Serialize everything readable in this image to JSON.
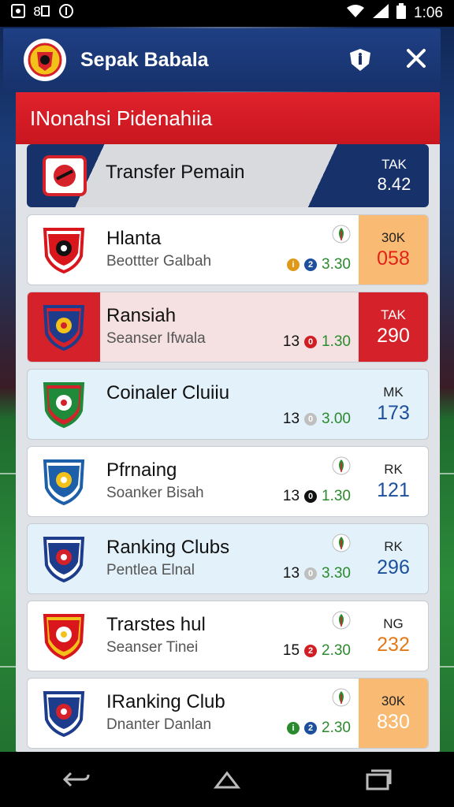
{
  "status_bar": {
    "time": "1:06",
    "left_icons": [
      "photo-icon",
      "notification-icon",
      "data-saver-icon"
    ],
    "right_icons": [
      "wifi-icon",
      "signal-icon",
      "battery-icon"
    ]
  },
  "app_bar": {
    "title": "Sepak Babala",
    "logo": "club-crest-icon",
    "action_icons": [
      "shield-icon",
      "close-icon"
    ]
  },
  "panel": {
    "title": "INonahsi Pidenahiia"
  },
  "featured": {
    "title": "Transfer Pemain",
    "rank_label": "TAK",
    "rank_value": "8.42",
    "colors": {
      "left": "#17326b",
      "right": "#17326b",
      "mid": "#d8dadd"
    }
  },
  "cards": [
    {
      "name": "Hlanta",
      "sub": "Beottter Galbah",
      "stat_num": "",
      "stat_val": "3.30",
      "rank_label": "30K",
      "rank_value": "058",
      "rank_color": "#e2231a",
      "rank_bg": "#f9bb73",
      "card_bg": "#ffffff",
      "trend": true,
      "dot1": "#e0981a",
      "dot2": "#1d4f9c",
      "dot_chars": [
        "i",
        "2"
      ],
      "crest_colors": [
        "#d8161b",
        "#111111",
        "#ffffff"
      ]
    },
    {
      "name": "Ransiah",
      "sub": "Seanser Ifwala",
      "stat_num": "13",
      "stat_val": "1.30",
      "rank_label": "TAK",
      "rank_value": "290",
      "rank_color": "#ffffff",
      "rank_bg": "#d5212a",
      "card_bg": "#f5e1e1",
      "badge_bg": "#d5212a",
      "trend": false,
      "dot1": "#d01e25",
      "dot2": "",
      "dot_chars": [
        "0",
        ""
      ],
      "crest_colors": [
        "#1d3c8c",
        "#f2c21b",
        "#d5212a"
      ]
    },
    {
      "name": "Coinaler Cluiiu",
      "sub": "",
      "stat_num": "13",
      "stat_val": "3.00",
      "rank_label": "MK",
      "rank_value": "173",
      "rank_color": "#1d4f9c",
      "rank_bg": "transparent",
      "card_bg": "#e2f1fa",
      "trend": false,
      "dot1": "#bfbfbf",
      "dot2": "",
      "dot_chars": [
        "0",
        ""
      ],
      "crest_colors": [
        "#1f8a3a",
        "#ffffff",
        "#d5212a"
      ]
    },
    {
      "name": "Pfrnaing",
      "sub": "Soanker Bisah",
      "stat_num": "13",
      "stat_val": "1.30",
      "rank_label": "RK",
      "rank_value": "121",
      "rank_color": "#1d4f9c",
      "rank_bg": "transparent",
      "card_bg": "#ffffff",
      "trend": true,
      "dot1": "#111111",
      "dot2": "",
      "dot_chars": [
        "0",
        ""
      ],
      "crest_colors": [
        "#1d5fa8",
        "#f2c21b",
        "#ffffff"
      ]
    },
    {
      "name": "Ranking Clubs",
      "sub": "Pentlea Elnal",
      "stat_num": "13",
      "stat_val": "3.30",
      "rank_label": "RK",
      "rank_value": "296",
      "rank_color": "#1d4f9c",
      "rank_bg": "transparent",
      "card_bg": "#e2f1fa",
      "trend": true,
      "dot1": "#bfbfbf",
      "dot2": "",
      "dot_chars": [
        "0",
        ""
      ],
      "crest_colors": [
        "#1d3c8c",
        "#d5212a",
        "#ffffff"
      ]
    },
    {
      "name": "Trarstes hul",
      "sub": "Seanser Tinei",
      "stat_num": "15",
      "stat_val": "2.30",
      "rank_label": "NG",
      "rank_value": "232",
      "rank_color": "#e27a1a",
      "rank_bg": "transparent",
      "card_bg": "#ffffff",
      "trend": true,
      "dot1": "#d01e25",
      "dot2": "",
      "dot_chars": [
        "2",
        ""
      ],
      "crest_colors": [
        "#d8161b",
        "#ffffff",
        "#f2c21b"
      ]
    },
    {
      "name": "IRanking Club",
      "sub": "Dnanter Danlan",
      "stat_num": "",
      "stat_val": "2.30",
      "rank_label": "30K",
      "rank_value": "830",
      "rank_color": "#ffffff",
      "rank_bg": "#f9bb73",
      "card_bg": "#ffffff",
      "trend": true,
      "dot1": "#2a8a2d",
      "dot2": "#1d4f9c",
      "dot_chars": [
        "i",
        "2"
      ],
      "crest_colors": [
        "#1d3c8c",
        "#d5212a",
        "#ffffff"
      ]
    }
  ],
  "nav_bar": {
    "buttons": [
      "back-icon",
      "home-icon",
      "recents-icon"
    ]
  }
}
